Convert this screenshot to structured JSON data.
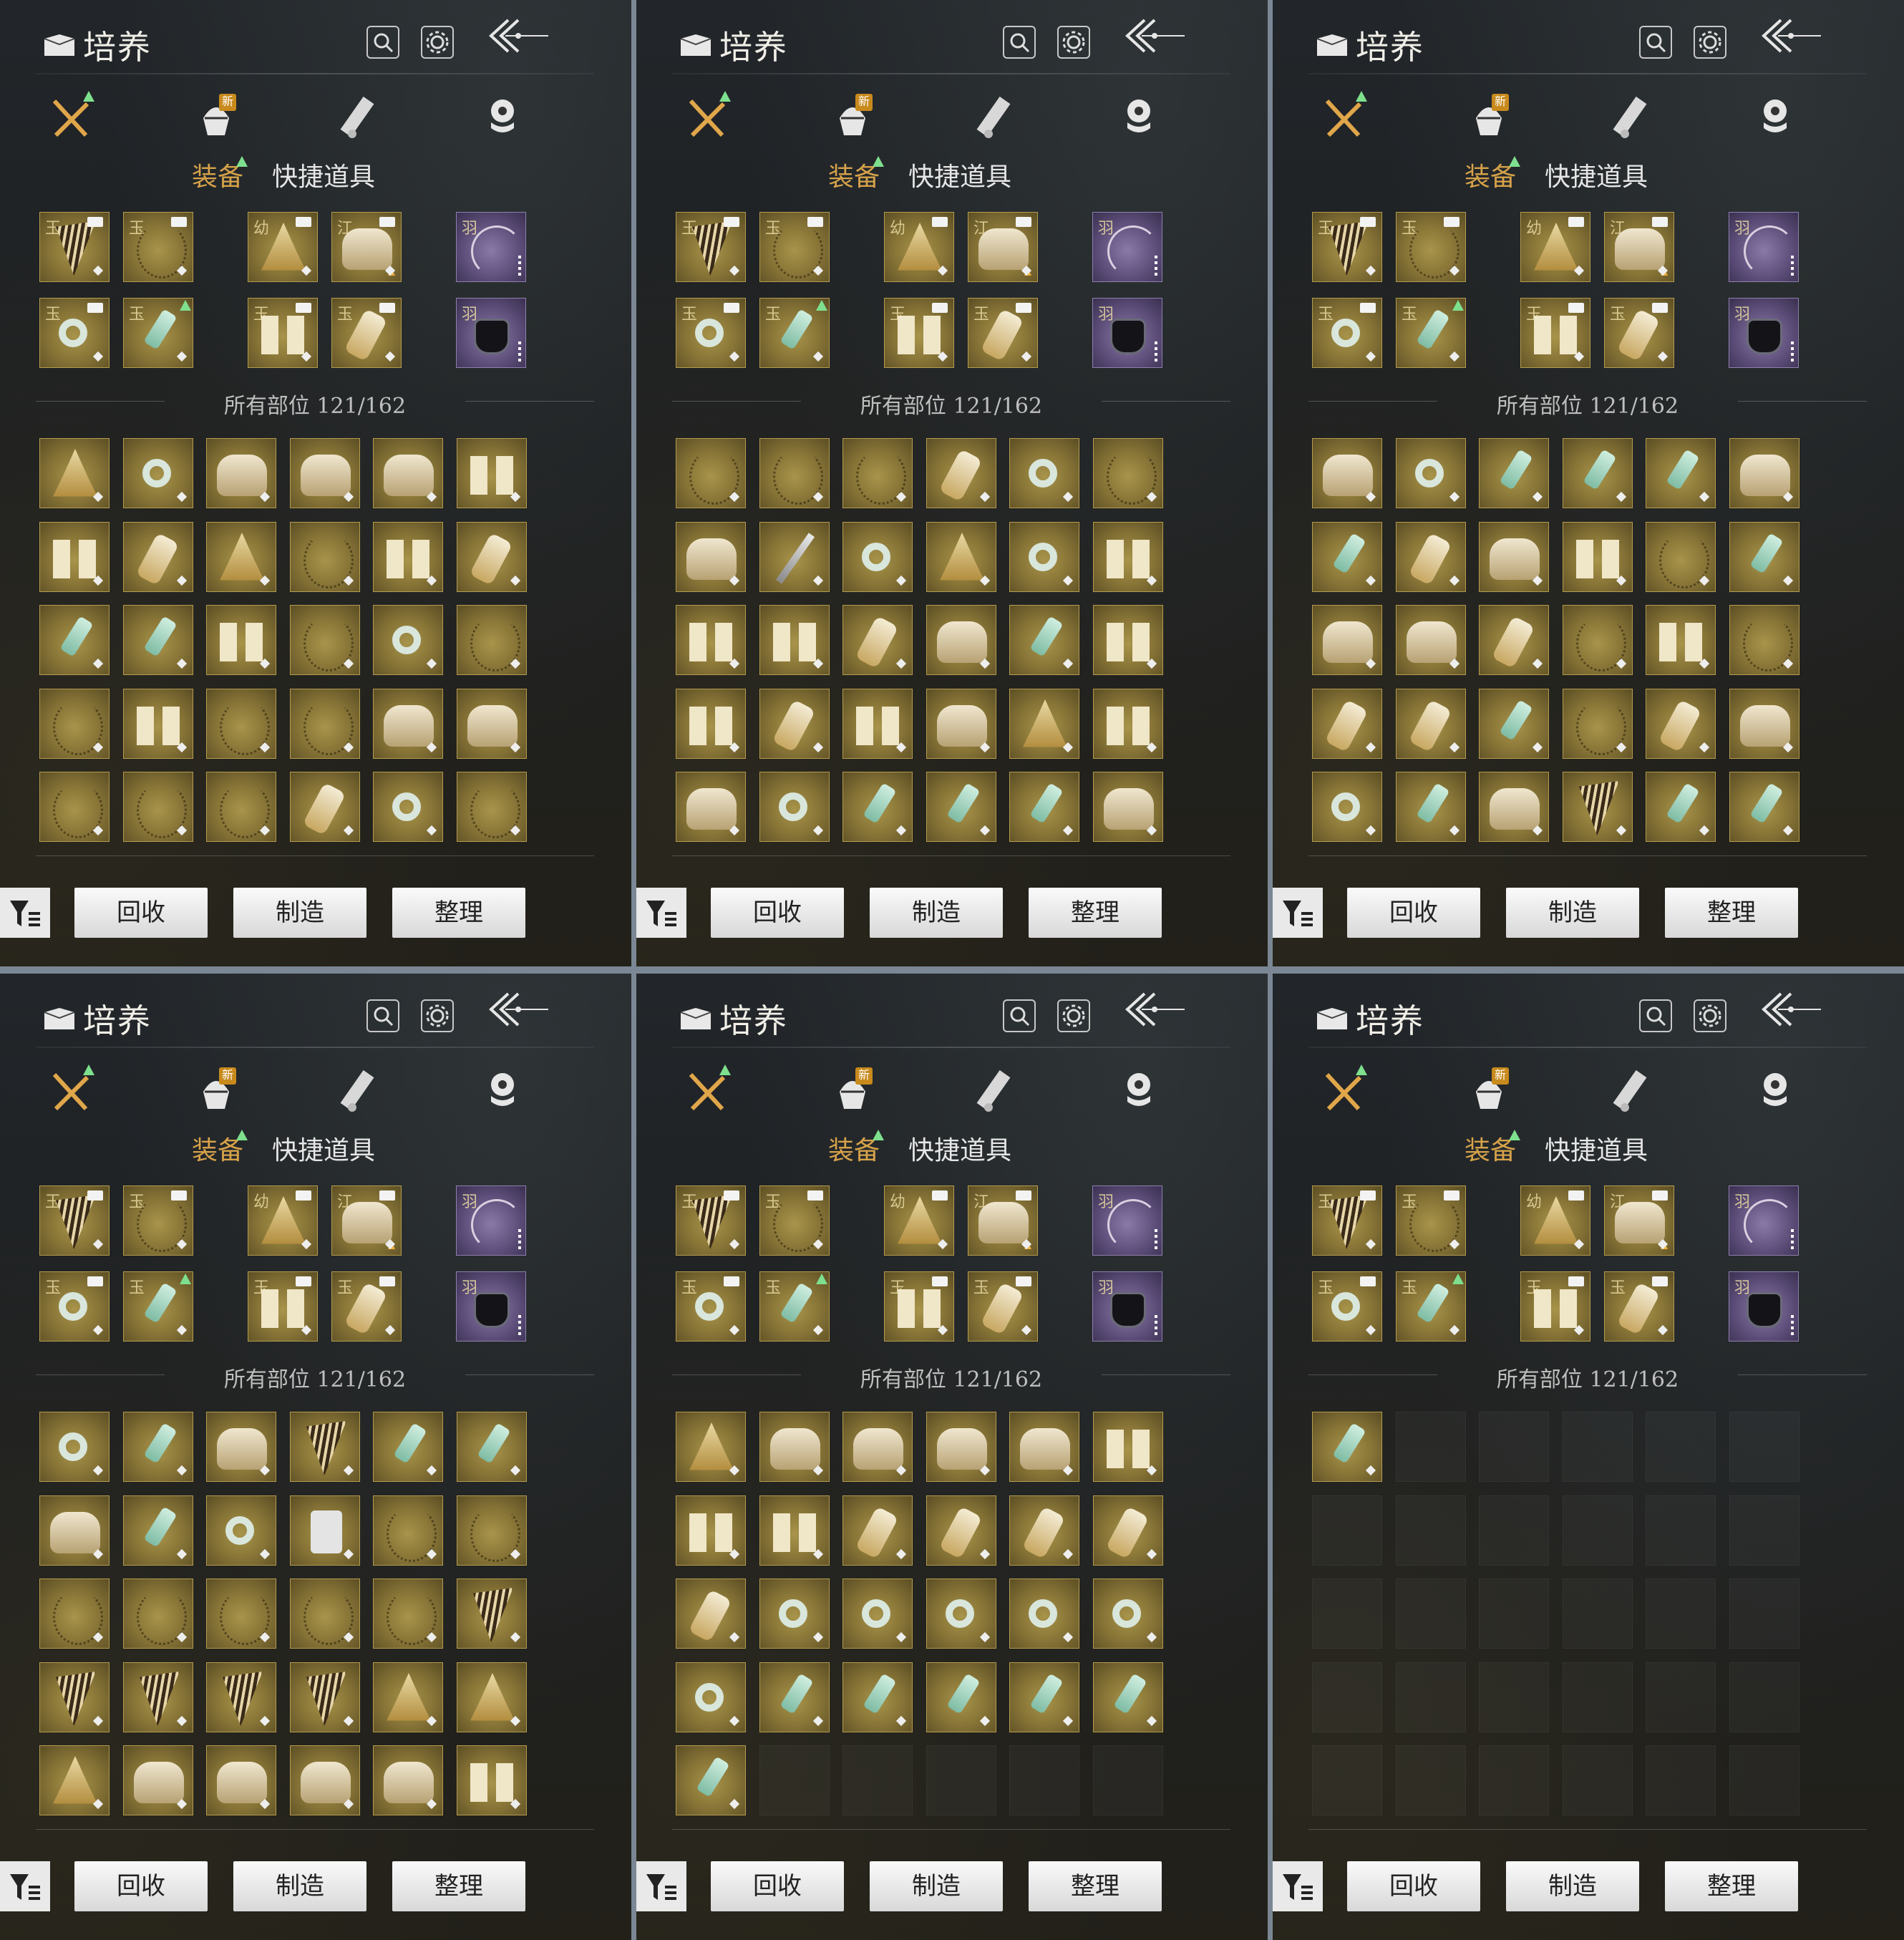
{
  "header": {
    "title": "培养"
  },
  "category_tabs": {
    "new_badge": "新",
    "icons": [
      "equipment-icon",
      "bag-icon",
      "scroll-icon",
      "coin-icon"
    ]
  },
  "sub_tabs": {
    "equipment": "装备",
    "quick_items": "快捷道具"
  },
  "section": {
    "all_slots_label": "所有部位 121/162"
  },
  "actions": {
    "recycle": "回收",
    "craft": "制造",
    "organize": "整理"
  },
  "equipped_slots": {
    "row1": [
      {
        "q": "玉",
        "icon": "fan",
        "badge": "pin"
      },
      {
        "q": "玉",
        "icon": "neck",
        "badge": "pin"
      },
      {
        "q": "幼",
        "icon": "hat",
        "badge": "pin"
      },
      {
        "q": "江",
        "icon": "armor",
        "badge": "pin",
        "extra": "arrow"
      },
      {
        "q": "羽",
        "icon": "bow",
        "rarity": "purple",
        "extra": "dots"
      }
    ],
    "row2": [
      {
        "q": "玉",
        "icon": "ring",
        "badge": "pin"
      },
      {
        "q": "玉",
        "icon": "pendant",
        "extra": "tri"
      },
      {
        "q": "玉",
        "icon": "glove",
        "badge": "pin"
      },
      {
        "q": "玉",
        "icon": "boot",
        "badge": "pin"
      },
      {
        "q": "羽",
        "icon": "cup",
        "rarity": "purple",
        "extra": "dots"
      }
    ]
  },
  "panels": [
    {
      "id": "p1",
      "inventory": [
        "hat",
        "ring",
        "armor",
        "armor",
        "armor",
        "glove",
        "glove",
        "boot",
        "hat",
        "neck",
        "glove",
        "boot",
        "pendant",
        "pendant",
        "glove",
        "neck",
        "ring",
        "neck",
        "neck",
        "glove",
        "neck",
        "neck",
        "armor",
        "armor",
        "neck",
        "neck",
        "neck",
        "boot",
        "ring",
        "neck"
      ]
    },
    {
      "id": "p2",
      "inventory": [
        "neck",
        "neck",
        "neck",
        "boot",
        "ring",
        "neck",
        "armor",
        "blade",
        "ring",
        "hat",
        "ring",
        "glove",
        "glove",
        "glove",
        "boot",
        "armor",
        "pendant",
        "glove",
        "glove",
        "boot",
        "glove",
        "armor",
        "hat",
        "glove",
        "armor",
        "ring",
        "pendant",
        "pendant",
        "pendant",
        "armor"
      ]
    },
    {
      "id": "p3",
      "inventory": [
        "armor",
        "ring",
        "pendant",
        "pendant",
        "pendant",
        "armor",
        "pendant",
        "boot",
        "armor",
        "glove",
        "neck",
        "pendant",
        "armor",
        "armor",
        "boot",
        "neck",
        "glove",
        "neck",
        "boot",
        "boot",
        "pendant",
        "neck",
        "boot",
        "armor",
        "ring",
        "pendant",
        "armor",
        "fan",
        "pendant",
        "pendant"
      ]
    },
    {
      "id": "p4",
      "inventory": [
        "ring",
        "pendant",
        "armor",
        "fan",
        "pendant",
        "pendant",
        "armor",
        "pendant",
        "ring",
        "box",
        "neck",
        "neck",
        "neck",
        "neck",
        "neck",
        "neck",
        "neck",
        "fan",
        "fan",
        "fan",
        "fan",
        "fan",
        "hat",
        "hat",
        "hat",
        "armor",
        "armor",
        "armor",
        "armor",
        "glove"
      ]
    },
    {
      "id": "p5",
      "inventory": [
        "hat",
        "armor",
        "armor",
        "armor",
        "armor",
        "glove",
        "glove",
        "glove",
        "boot",
        "boot",
        "boot",
        "boot",
        "boot",
        "ring",
        "ring",
        "ring",
        "ring",
        "ring",
        "ring",
        "pendant",
        "pendant",
        "pendant",
        "pendant",
        "pendant",
        "pendant",
        "",
        "",
        "",
        "",
        ""
      ]
    },
    {
      "id": "p6",
      "inventory": [
        "pendant",
        "",
        "",
        "",
        "",
        "",
        "",
        "",
        "",
        "",
        "",
        "",
        "",
        "",
        "",
        "",
        "",
        "",
        "",
        "",
        "",
        "",
        "",
        "",
        "",
        "",
        "",
        "",
        "",
        ""
      ]
    }
  ],
  "colors": {
    "gold_slot": "#8a7738",
    "purple_slot": "#5d4e7a",
    "active_tab": "#d6a24a",
    "indicator": "#7ee08e"
  }
}
